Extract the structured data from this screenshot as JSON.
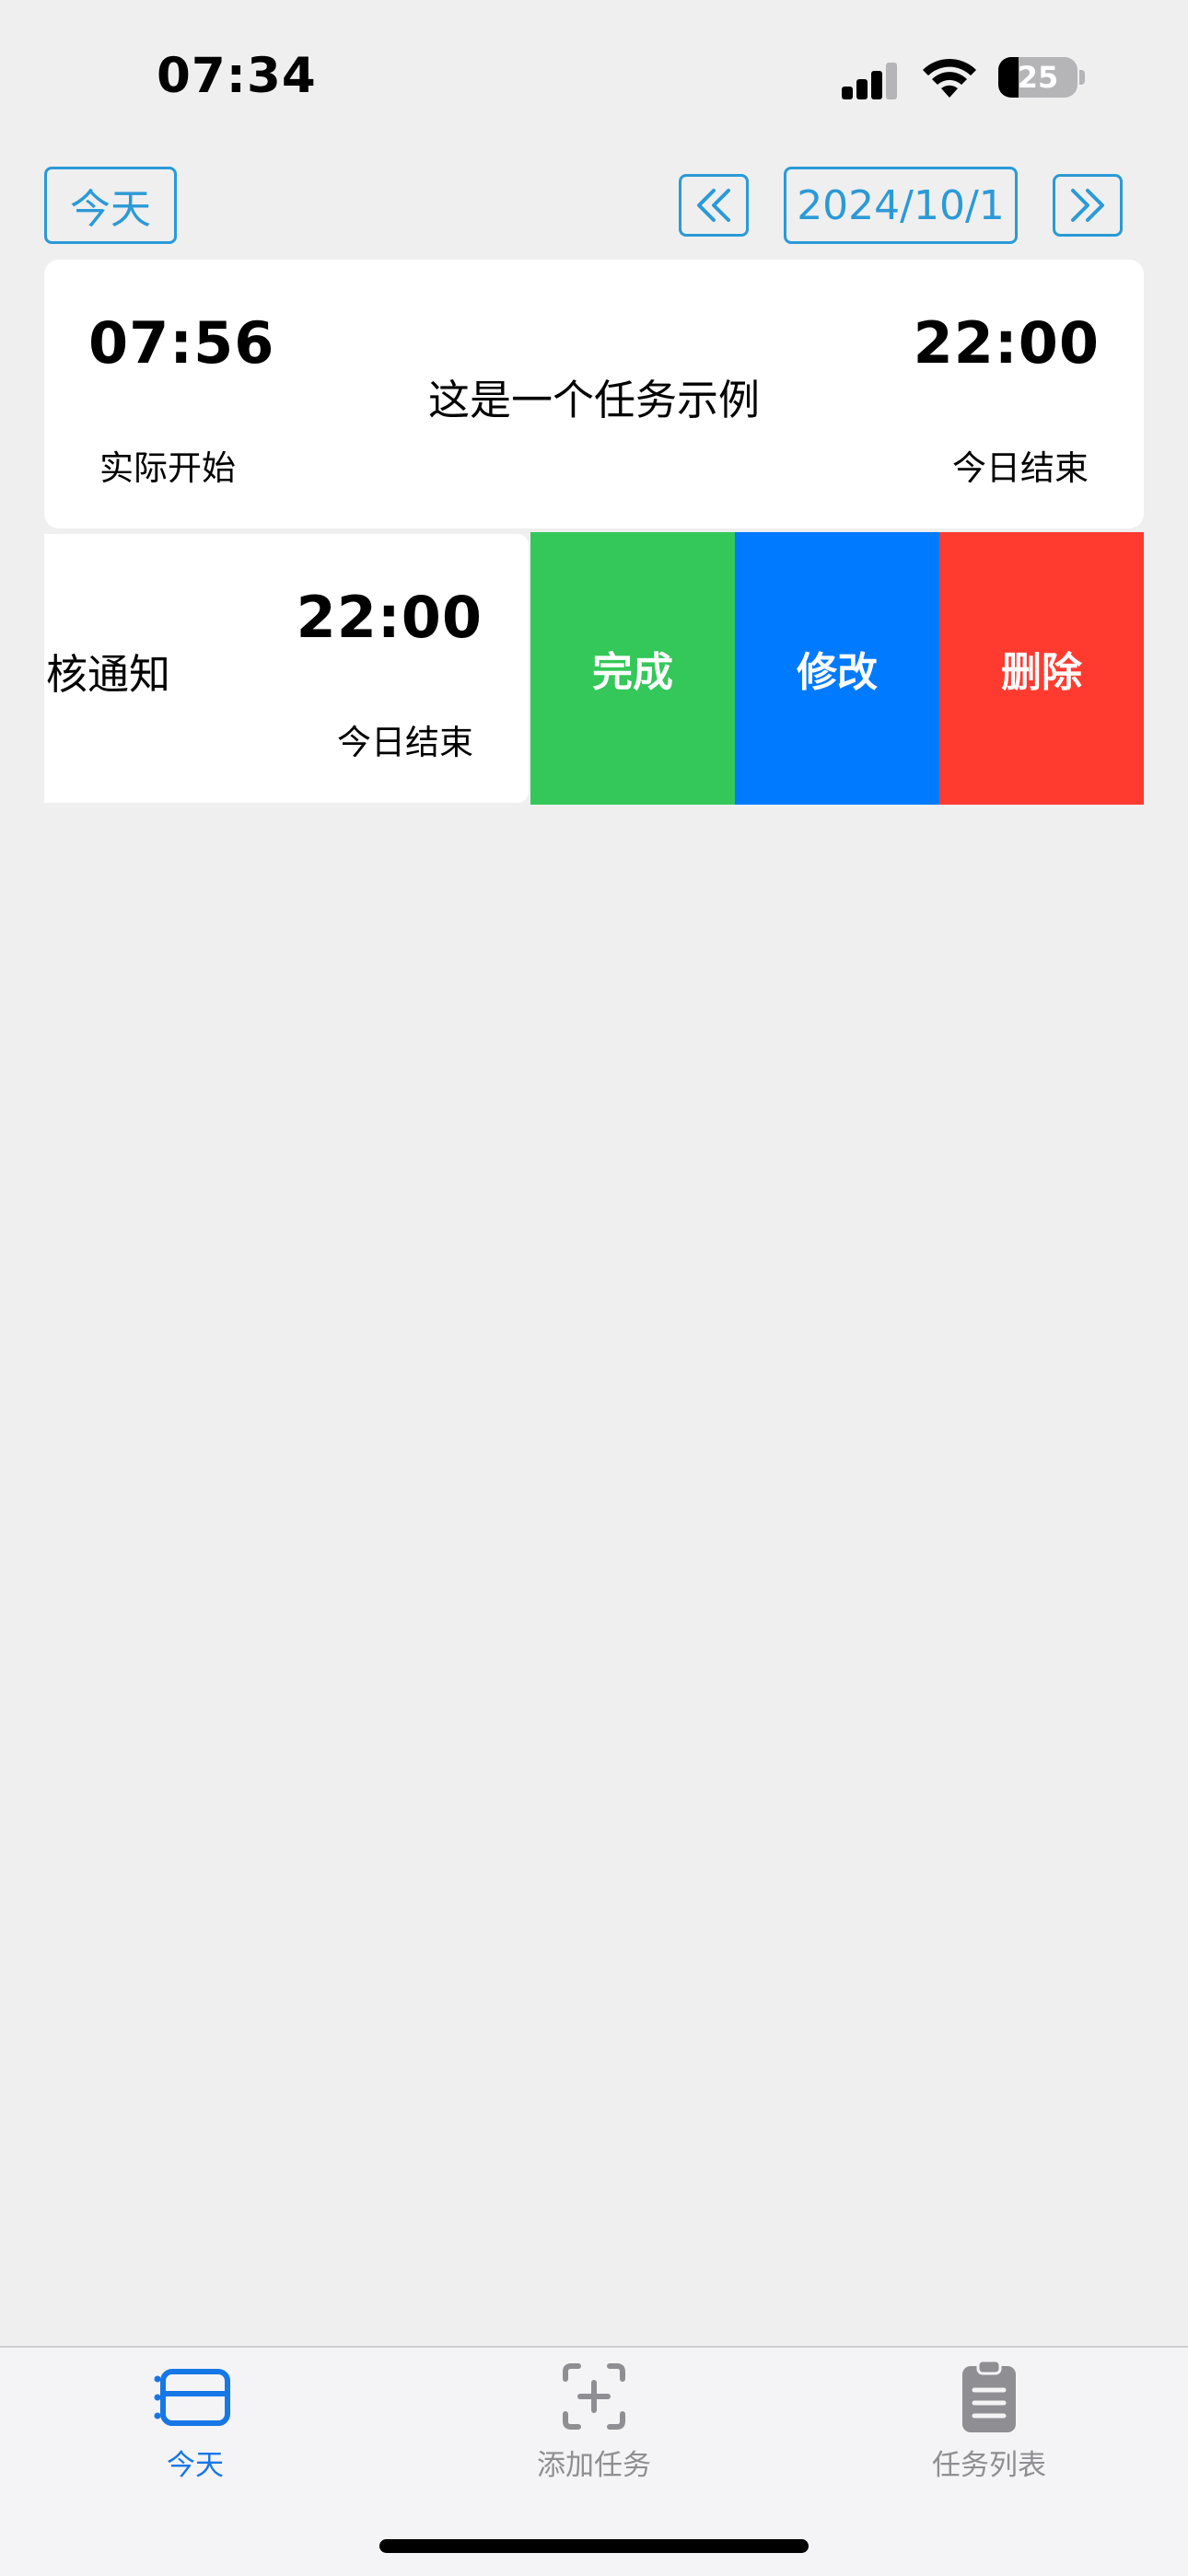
{
  "status_bar": {
    "time": "07:34",
    "battery": "25"
  },
  "header": {
    "today_label": "今天",
    "date": "2024/10/1"
  },
  "task_card": {
    "start_time": "07:56",
    "start_label": "实际开始",
    "title": "这是一个任务示例",
    "end_time": "22:00",
    "end_label": "今日结束"
  },
  "swiped_card": {
    "title_partial": "核通知",
    "end_time": "22:00",
    "end_label": "今日结束",
    "actions": {
      "complete": "完成",
      "edit": "修改",
      "delete": "删除"
    }
  },
  "tabbar": {
    "tabs": [
      {
        "label": "今天",
        "icon": "calendar-today-icon",
        "active": true
      },
      {
        "label": "添加任务",
        "icon": "add-task-icon",
        "active": false
      },
      {
        "label": "任务列表",
        "icon": "clipboard-list-icon",
        "active": false
      }
    ]
  },
  "colors": {
    "accent": "#2b9ad6",
    "tab_active": "#1677e6",
    "complete": "#34c759",
    "edit": "#007aff",
    "delete": "#ff3b30"
  }
}
